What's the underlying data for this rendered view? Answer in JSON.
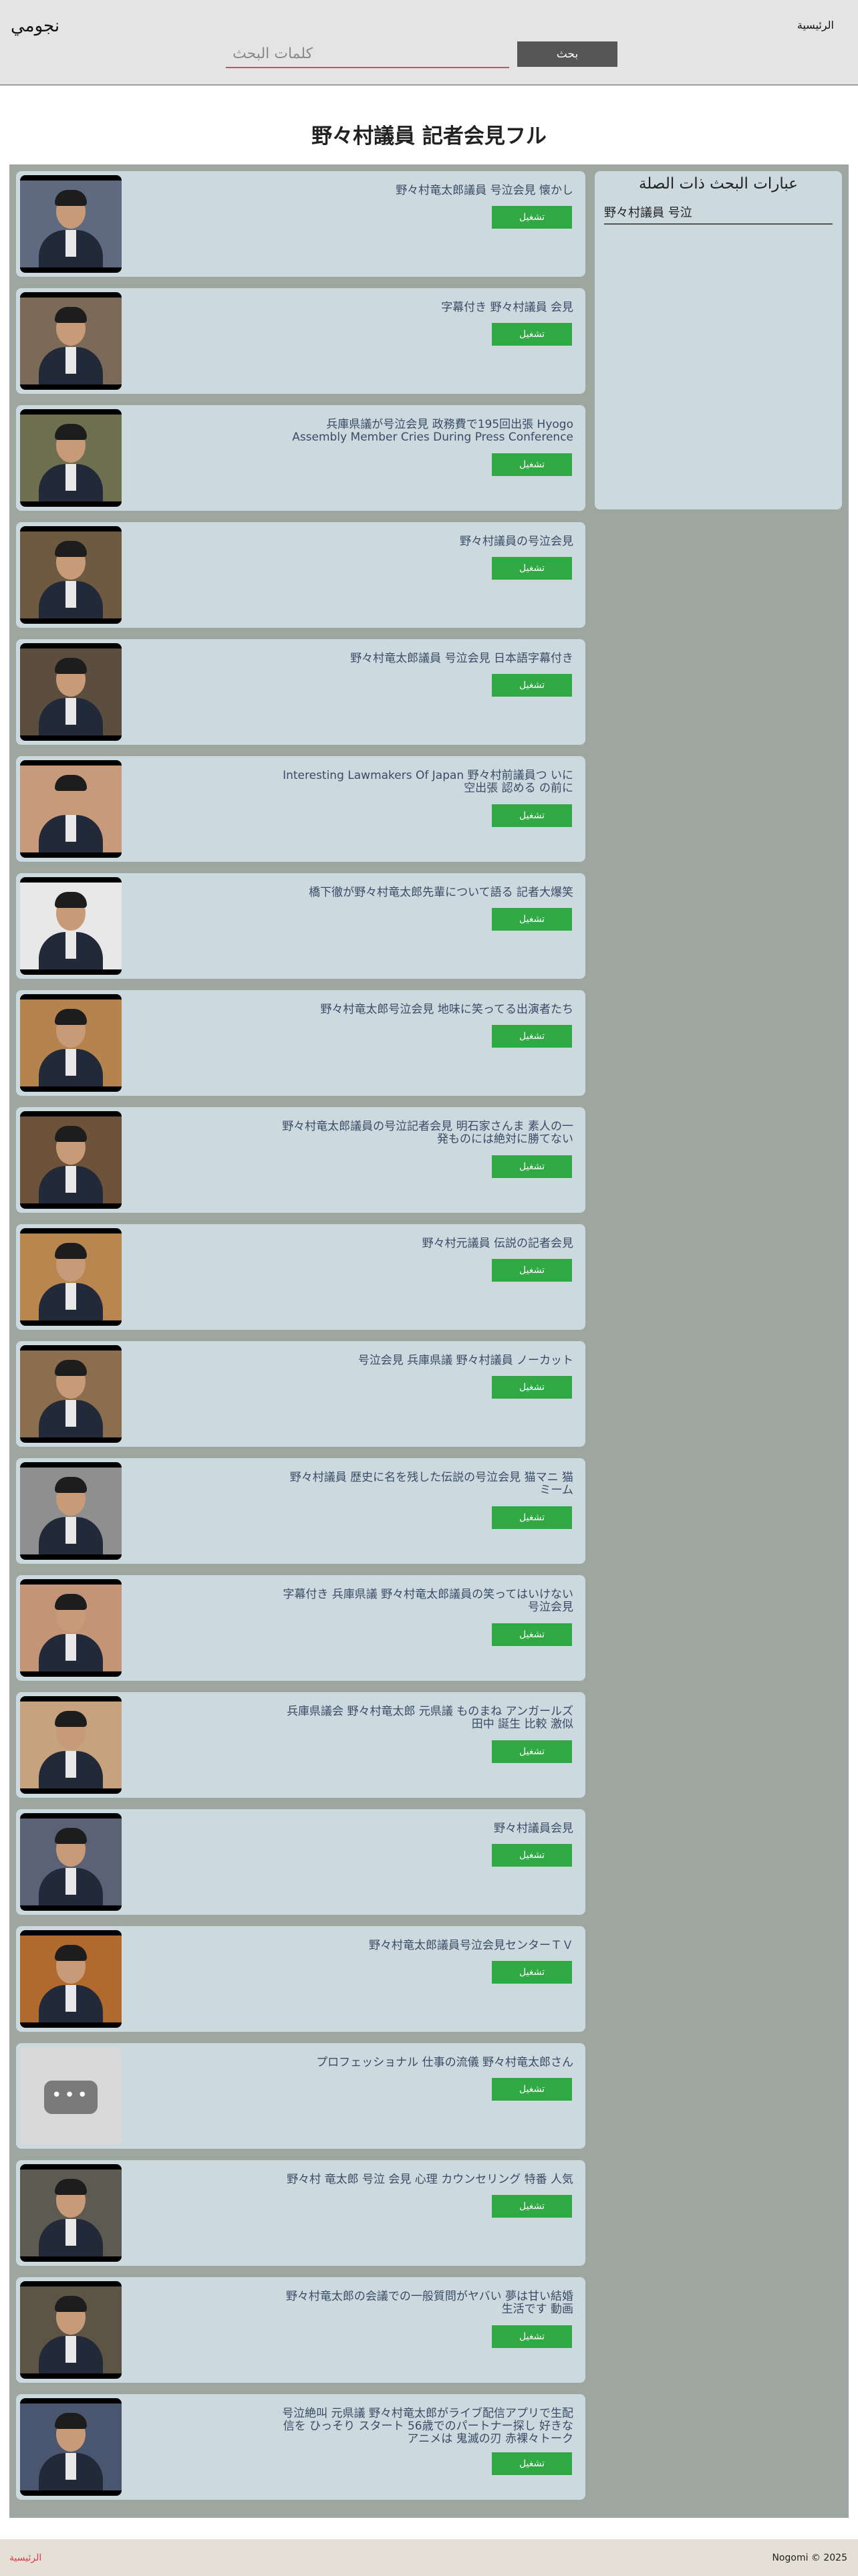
{
  "header": {
    "logo": "نجومي",
    "home_link": "الرئيسية",
    "search_placeholder": "كلمات البحث",
    "search_button": "بحث"
  },
  "page_title": "野々村議員 記者会見フル",
  "play_label": "تشغيل",
  "sidebar": {
    "title": "عبارات البحث ذات الصلة",
    "items": [
      "野々村議員 号泣"
    ]
  },
  "results": [
    {
      "title": "野々村竜太郎議員 号泣会見 懐かし",
      "thumb_color": "#5f6a80"
    },
    {
      "title": "字幕付き 野々村議員 会見",
      "thumb_color": "#7c6a58"
    },
    {
      "title": "兵庫県議が号泣会見 政務費で195回出張 Hyogo Assembly Member Cries During Press Conference",
      "thumb_color": "#6d6f4f"
    },
    {
      "title": "野々村議員の号泣会見",
      "thumb_color": "#6e5a40"
    },
    {
      "title": "野々村竜太郎議員 号泣会見 日本語字幕付き",
      "thumb_color": "#5b4e3e"
    },
    {
      "title": "Interesting Lawmakers Of Japan 野々村前議員つ いに 空出張 認める の前に",
      "thumb_color": "#c89a7c"
    },
    {
      "title": "橋下徹が野々村竜太郎先輩について語る 記者大爆笑",
      "thumb_color": "#e8e8e8"
    },
    {
      "title": "野々村竜太郎号泣会見 地味に笑ってる出演者たち",
      "thumb_color": "#b4834e"
    },
    {
      "title": "野々村竜太郎議員の号泣記者会見 明石家さんま 素人の一発ものには絶対に勝てない",
      "thumb_color": "#6b5238"
    },
    {
      "title": "野々村元議員 伝説の記者会見",
      "thumb_color": "#b98650"
    },
    {
      "title": "号泣会見 兵庫県議 野々村議員 ノーカット",
      "thumb_color": "#8b6e4e"
    },
    {
      "title": "野々村議員 歴史に名を残した伝説の号泣会見 猫マニ 猫ミーム",
      "thumb_color": "#8f8f8f"
    },
    {
      "title": "字幕付き 兵庫県議 野々村竜太郎議員の笑ってはいけない号泣会見",
      "thumb_color": "#c49476"
    },
    {
      "title": "兵庫県議会 野々村竜太郎 元県議 ものまね アンガールズ 田中 誕生 比較 激似",
      "thumb_color": "#c7a27e"
    },
    {
      "title": "野々村議員会見",
      "thumb_color": "#5b6275"
    },
    {
      "title": "野々村竜太郎議員号泣会見センターＴＶ",
      "thumb_color": "#b06a2e"
    },
    {
      "title": "プロフェッショナル 仕事の流儀 野々村竜太郎さん",
      "thumb_color": "#d9d9d9",
      "placeholder": true
    },
    {
      "title": "野々村 竜太郎 号泣 会見 心理 カウンセリング 特番 人気",
      "thumb_color": "#5d5a52"
    },
    {
      "title": "野々村竜太郎の会議での一般質問がヤバい 夢は甘い結婚生活です 動画",
      "thumb_color": "#5c5444"
    },
    {
      "title": "号泣絶叫 元県議 野々村竜太郎がライブ配信アプリで生配信を ひっそり スタート 56歳でのパートナー探し 好きなアニメは 鬼滅の刃 赤裸々トーク",
      "thumb_color": "#4a5570"
    }
  ],
  "footer": {
    "home_link": "الرئيسية",
    "copyright": "Nogomi © 2025"
  }
}
